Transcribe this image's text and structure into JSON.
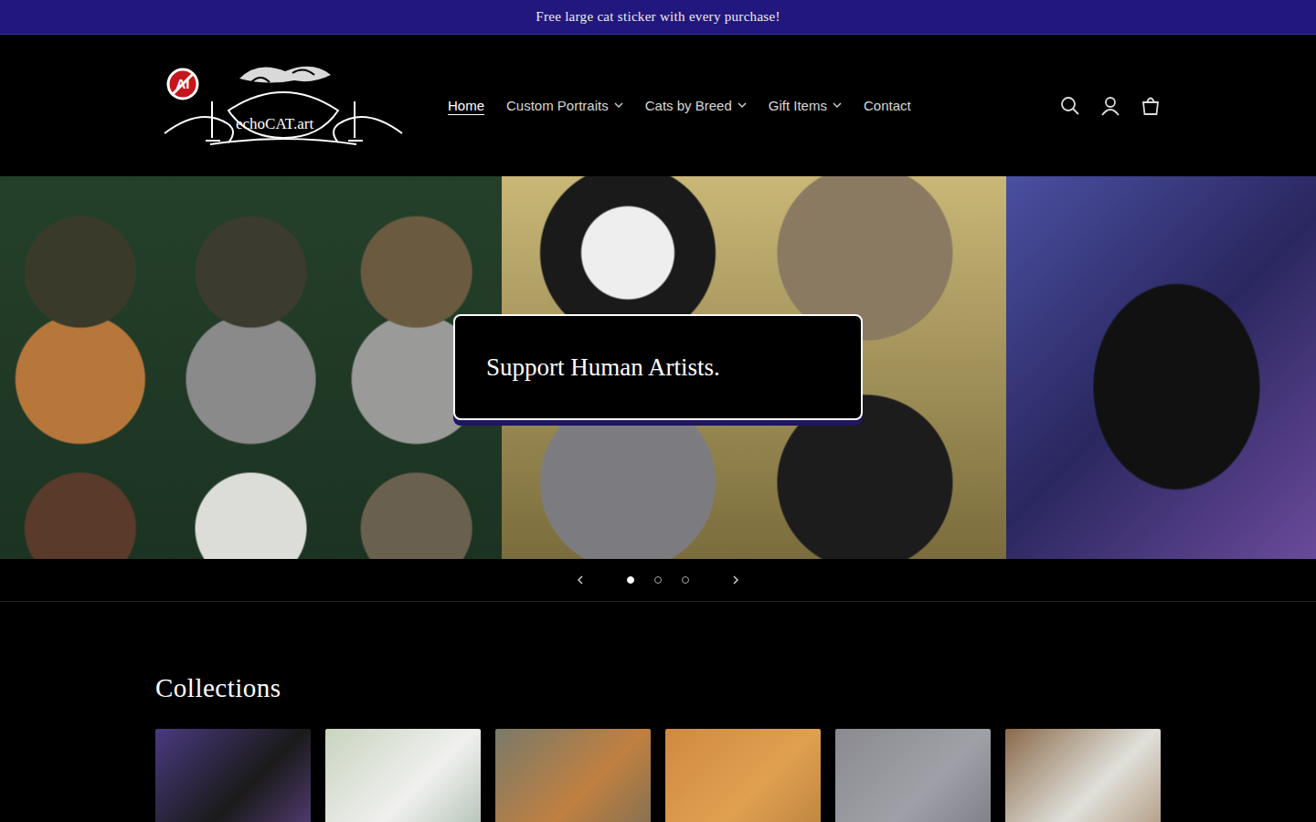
{
  "announcement": "Free large cat sticker with every purchase!",
  "logo": {
    "badge": "AI",
    "text": "echoCAT.art"
  },
  "nav": [
    {
      "label": "Home",
      "selected": true,
      "dropdown": false
    },
    {
      "label": "Custom Portraits",
      "selected": false,
      "dropdown": true
    },
    {
      "label": "Cats by Breed",
      "selected": false,
      "dropdown": true
    },
    {
      "label": "Gift Items",
      "selected": false,
      "dropdown": true
    },
    {
      "label": "Contact",
      "selected": false,
      "dropdown": false
    }
  ],
  "slideshow": {
    "caption": "Support Human Artists.",
    "dots": [
      {
        "selected": true
      },
      {
        "selected": false
      },
      {
        "selected": false
      }
    ]
  },
  "collections": {
    "title": "Collections"
  }
}
